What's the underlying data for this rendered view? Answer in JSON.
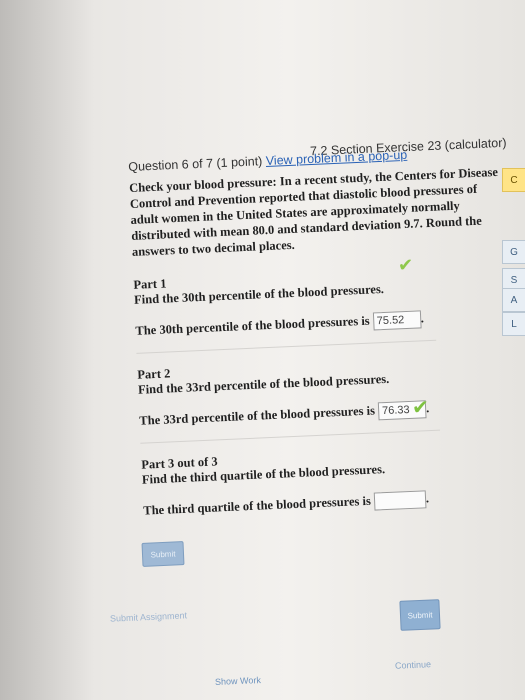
{
  "header": {
    "question_label": "Question 6 of 7 (1 point)",
    "view_link": "View problem in a pop-up",
    "section_title": "7.2 Section Exercise 23 (calculator)"
  },
  "problem": {
    "text": "Check your blood pressure: In a recent study, the Centers for Disease Control and Prevention reported that diastolic blood pressures of adult women in the United States are approximately normally distributed with mean 80.0 and standard deviation 9.7. Round the answers to two decimal places."
  },
  "parts": [
    {
      "title": "Part 1",
      "instruction": "Find the 30th percentile of the blood pressures.",
      "answer_prefix": "The 30th percentile of the blood pressures is",
      "answer_value": "75.52"
    },
    {
      "title": "Part 2",
      "instruction": "Find the 33rd percentile of the blood pressures.",
      "answer_prefix": "The 33rd percentile of the blood pressures is",
      "answer_value": "76.33"
    },
    {
      "title": "Part 3 out of 3",
      "instruction": "Find the third quartile of the blood pressures.",
      "answer_prefix": "The third quartile of the blood pressures is",
      "answer_value": ""
    }
  ],
  "buttons": {
    "submit_left": "Submit",
    "submit_right": "Submit"
  },
  "sidebar_tabs": {
    "c": "C",
    "g": "G",
    "s": "S",
    "a": "A",
    "l": "L"
  },
  "footer": {
    "left": "Submit Assignment",
    "right": "Continue",
    "bottom": "Show Work"
  },
  "colors": {
    "link": "#2a62b6",
    "check": "#8fc84c",
    "button": "#9fb9d5"
  },
  "icons": {
    "check1": "✔",
    "check2": "✔"
  }
}
